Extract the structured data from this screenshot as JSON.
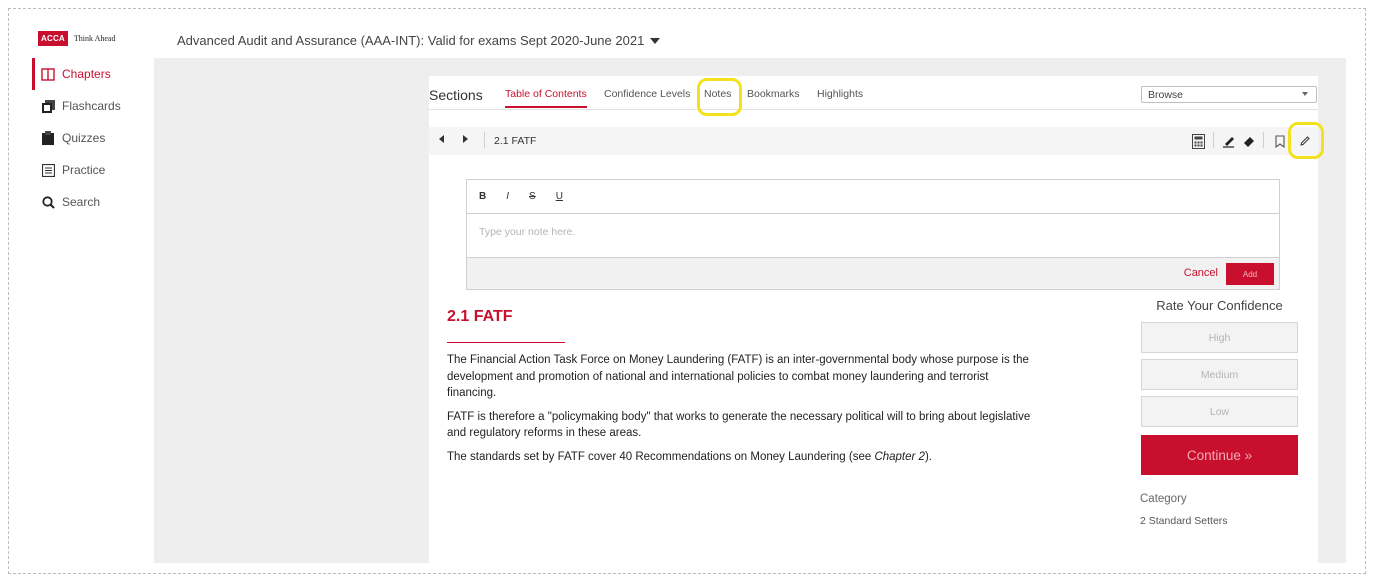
{
  "brand": {
    "logo_mark": "ACCA",
    "logo_tagline": "Think Ahead"
  },
  "course": {
    "title": "Advanced Audit and Assurance (AAA-INT): Valid for exams Sept 2020-June 2021"
  },
  "sidebar": {
    "items": [
      {
        "label": "Chapters",
        "icon": "book-icon",
        "active": true
      },
      {
        "label": "Flashcards",
        "icon": "flashcards-icon",
        "active": false
      },
      {
        "label": "Quizzes",
        "icon": "clipboard-icon",
        "active": false
      },
      {
        "label": "Practice",
        "icon": "list-icon",
        "active": false
      },
      {
        "label": "Search",
        "icon": "search-icon",
        "active": false
      }
    ]
  },
  "sections": {
    "label": "Sections",
    "tabs": [
      {
        "label": "Table of Contents",
        "active": true
      },
      {
        "label": "Confidence Levels",
        "active": false
      },
      {
        "label": "Notes",
        "active": false
      },
      {
        "label": "Bookmarks",
        "active": false
      },
      {
        "label": "Highlights",
        "active": false
      }
    ],
    "browse": {
      "selected": "Browse"
    }
  },
  "toolbar": {
    "breadcrumb": "2.1 FATF",
    "icons": [
      "prev-arrow-icon",
      "next-arrow-icon",
      "calculator-icon",
      "highlighter-icon",
      "eraser-icon",
      "bookmark-icon",
      "pencil-icon"
    ]
  },
  "editor": {
    "format_buttons": [
      "B",
      "I",
      "S",
      "U"
    ],
    "placeholder": "Type your note here.",
    "cancel_label": "Cancel",
    "add_label": "Add"
  },
  "article": {
    "title": "2.1 FATF",
    "paragraph1": "The Financial Action Task Force on Money Laundering (FATF) is an inter-governmental body whose purpose is the development and promotion of national and international policies to combat money laundering and terrorist financing.",
    "paragraph2": "FATF is therefore a \"policymaking body\" that works to generate the necessary political will to bring about legislative and regulatory reforms in these areas.",
    "paragraph3_prefix": "The standards set by FATF cover 40 Recommendations on Money Laundering (see ",
    "paragraph3_ref": "Chapter 2",
    "paragraph3_suffix": ")."
  },
  "confidence": {
    "title": "Rate Your Confidence",
    "high": "High",
    "medium": "Medium",
    "low": "Low",
    "continue": "Continue »",
    "category_label": "Category",
    "category_value": "2 Standard Setters"
  },
  "colors": {
    "accent": "#c8102e",
    "annotation": "#f2e11c",
    "panel": "#eeeeee"
  }
}
